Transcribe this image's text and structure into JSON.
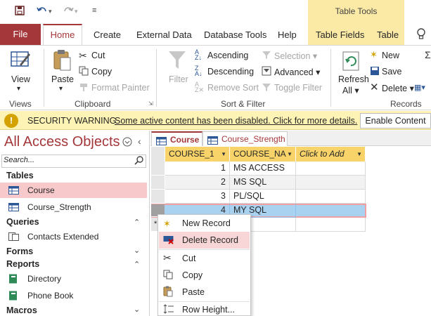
{
  "window": {
    "contextual_tab_group": "Table Tools"
  },
  "quick_access": {
    "save_icon": "save-icon",
    "undo_icon": "undo-icon",
    "redo_icon": "redo-icon",
    "customize_icon": "customize-icon"
  },
  "ribbon_tabs": {
    "file": "File",
    "home": "Home",
    "create": "Create",
    "external_data": "External Data",
    "database_tools": "Database Tools",
    "help": "Help",
    "table_fields": "Table Fields",
    "table": "Table"
  },
  "ribbon": {
    "views": {
      "label": "Views",
      "view": "View",
      "view_arrow": "▾"
    },
    "clipboard": {
      "label": "Clipboard",
      "paste": "Paste",
      "paste_arrow": "▾",
      "cut": "Cut",
      "copy": "Copy",
      "format_painter": "Format Painter"
    },
    "sort_filter": {
      "label": "Sort & Filter",
      "filter": "Filter",
      "ascending": "Ascending",
      "descending": "Descending",
      "remove_sort": "Remove Sort",
      "selection": "Selection",
      "advanced": "Advanced",
      "toggle_filter": "Toggle Filter"
    },
    "records": {
      "label": "Records",
      "refresh": "Refresh",
      "refresh_all": "All",
      "new": "New",
      "save": "Save",
      "delete": "Delete"
    }
  },
  "security_bar": {
    "title": "SECURITY WARNING",
    "message": "Some active content has been disabled. Click for more details.",
    "enable_button": "Enable Content"
  },
  "nav_pane": {
    "title": "All Access Objects",
    "search_placeholder": "Search...",
    "sections": [
      {
        "name": "Tables",
        "items": [
          "Course",
          "Course_Strength"
        ]
      },
      {
        "name": "Queries",
        "items": [
          "Contacts Extended"
        ]
      },
      {
        "name": "Forms",
        "items": []
      },
      {
        "name": "Reports",
        "items": [
          "Directory",
          "Phone Book"
        ]
      },
      {
        "name": "Macros",
        "items": []
      }
    ]
  },
  "doc_tabs": [
    "Course",
    "Course_Strength"
  ],
  "datasheet": {
    "columns": [
      "COURSE_1",
      "COURSE_NA",
      "Click to Add"
    ],
    "rows": [
      {
        "id": "1",
        "name": "MS ACCESS"
      },
      {
        "id": "2",
        "name": "MS SQL"
      },
      {
        "id": "3",
        "name": "PL/SQL"
      },
      {
        "id": "4",
        "name": "MY SQL"
      }
    ]
  },
  "context_menu": {
    "items": [
      {
        "label": "New Record",
        "icon": "new-record-icon"
      },
      {
        "label": "Delete Record",
        "icon": "delete-record-icon"
      },
      {
        "label": "Cut",
        "icon": "cut-icon"
      },
      {
        "label": "Copy",
        "icon": "copy-icon"
      },
      {
        "label": "Paste",
        "icon": "paste-icon"
      },
      {
        "label": "Row Height...",
        "icon": "row-height-icon"
      }
    ]
  },
  "colors": {
    "accent": "#a4373a",
    "contextual_tab": "#fbe9a6",
    "header_fill": "#f7d36a",
    "selected_row": "#a9d1f0",
    "nav_selected": "#f8c9cb"
  }
}
